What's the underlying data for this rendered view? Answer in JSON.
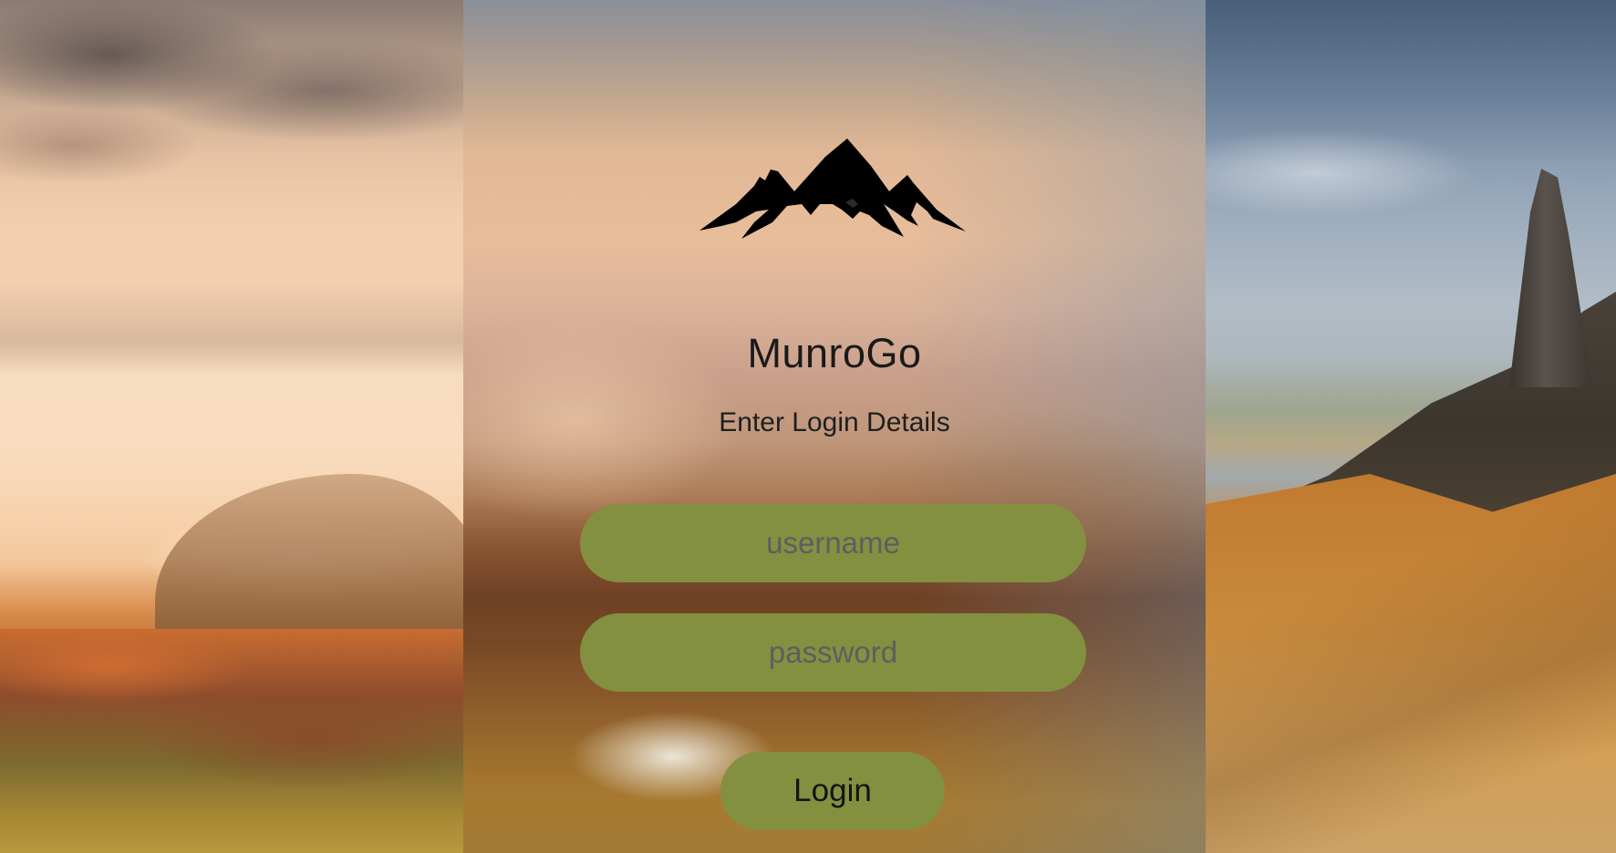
{
  "app": {
    "title": "MunroGo",
    "subtitle": "Enter Login Details",
    "logo_icon": "mountains-icon"
  },
  "form": {
    "username_placeholder": "username",
    "password_placeholder": "password",
    "login_label": "Login"
  },
  "colors": {
    "field_bg": "#83903f",
    "button_bg": "#83903f",
    "text_dark": "#1a1a1a",
    "placeholder": "#5a5f62"
  }
}
